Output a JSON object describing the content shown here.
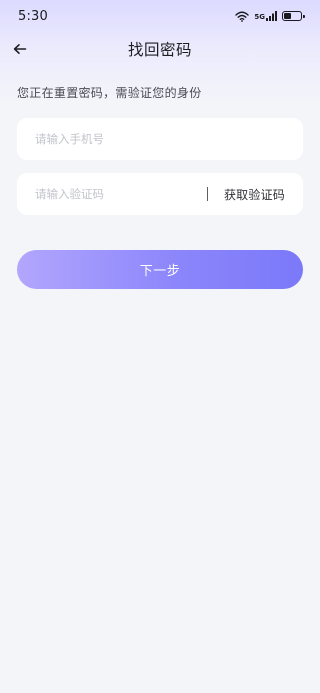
{
  "status_bar": {
    "time": "5:30",
    "signal_label": "5G",
    "battery_level": 0.45,
    "icons": [
      "wifi-icon",
      "cellular-signal-icon",
      "battery-icon"
    ]
  },
  "nav": {
    "back_icon": "arrow-left-icon",
    "title": "找回密码"
  },
  "hint": "您正在重置密码，需验证您的身份",
  "phone_field": {
    "placeholder": "请输入手机号",
    "value": ""
  },
  "code_field": {
    "placeholder": "请输入验证码",
    "value": "",
    "get_code_label": "获取验证码"
  },
  "next_button": {
    "label": "下一步"
  },
  "colors": {
    "accent_start": "#b2a6fd",
    "accent_end": "#7b79f9",
    "background": "#f4f5f9",
    "field_background": "#ffffff",
    "placeholder": "#c3c4cc"
  }
}
